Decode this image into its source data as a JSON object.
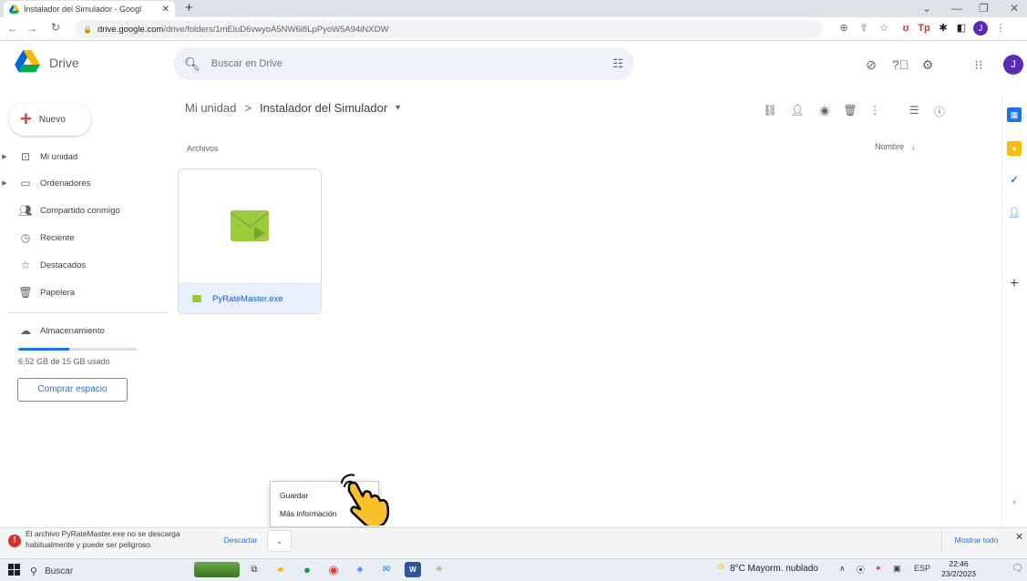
{
  "browser": {
    "tab_title": "Instalador del Simulador - Googl",
    "url_domain": "drive.google.com",
    "url_path": "/drive/folders/1mEluD6vwyoA5NW6i8LpPyoW5A94iNXDW",
    "profile_letter": "J"
  },
  "drive": {
    "brand": "Drive",
    "search_placeholder": "Buscar en Drive",
    "avatar": "J",
    "new_button": "Nuevo",
    "nav": [
      "Mi unidad",
      "Ordenadores",
      "Compartido conmigo",
      "Reciente",
      "Destacados",
      "Papelera",
      "Almacenamiento"
    ],
    "storage_text": "6,52 GB de 15 GB usado",
    "storage_fraction": 0.43,
    "buy_button": "Comprar espacio",
    "breadcrumb_root": "Mi unidad",
    "breadcrumb_sep": ">",
    "breadcrumb_current": "Instalador del Simulador",
    "section_label": "Archivos",
    "sort_label": "Nombre",
    "file_name": "PyRateMaster.exe"
  },
  "download_bar": {
    "message": "El archivo PyRateMaster.exe no se descarga habitualmente y puede ser peligroso.",
    "discard": "Descartar",
    "show_all": "Mostrar todo"
  },
  "context_menu": {
    "items": [
      "Guardar",
      "Más información"
    ]
  },
  "taskbar": {
    "search": "Buscar",
    "weather": "8°C Mayorm. nublado",
    "lang": "ESP",
    "time": "22:46",
    "date": "23/2/2023"
  },
  "colors": {
    "accent": "#1a73e8",
    "avatar": "#5b2bb5",
    "warning": "#d93025",
    "selected_file": "#e8f0fe"
  }
}
